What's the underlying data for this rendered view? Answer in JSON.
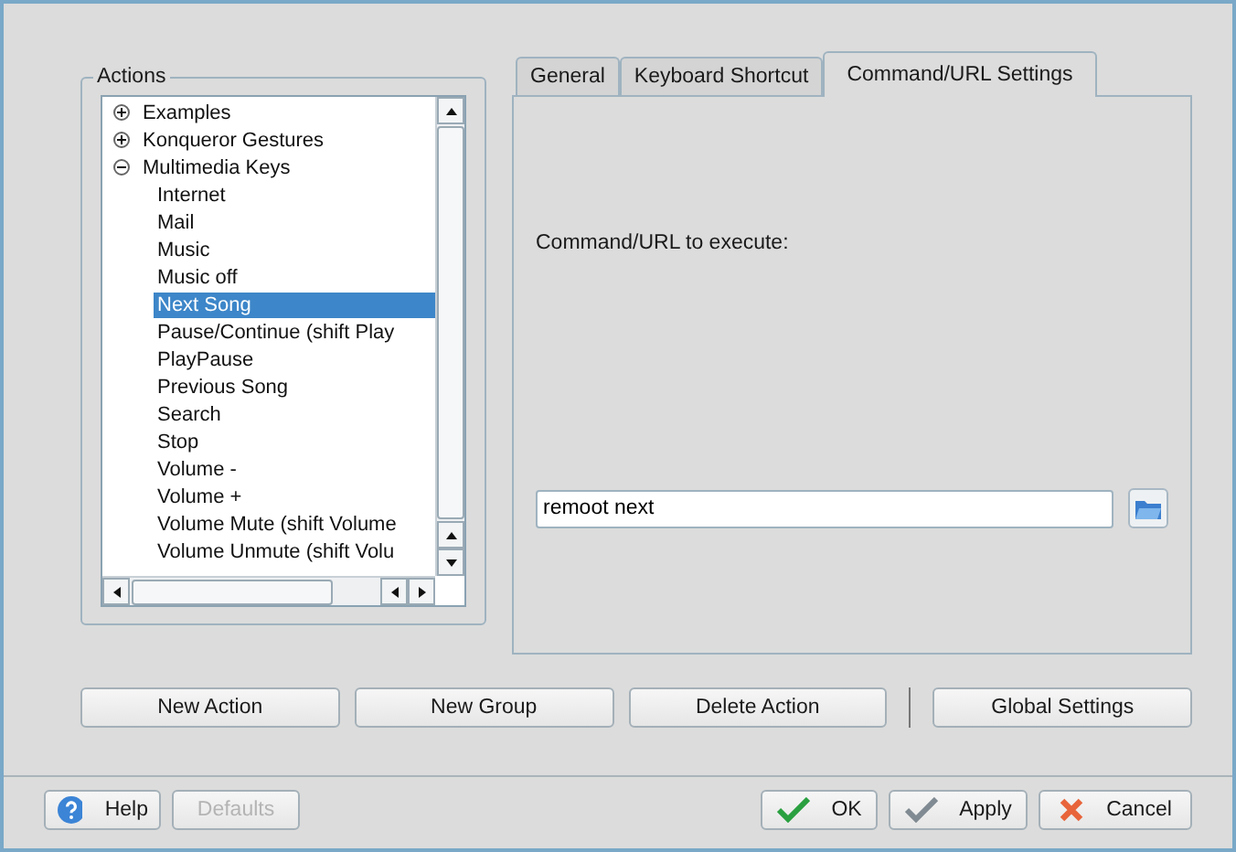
{
  "actions": {
    "title": "Actions",
    "tree": [
      {
        "label": "Examples",
        "expanded": false,
        "selected": false
      },
      {
        "label": "Konqueror Gestures",
        "expanded": false,
        "selected": false
      },
      {
        "label": "Multimedia Keys",
        "expanded": true,
        "selected": false,
        "children": [
          {
            "label": "Internet",
            "selected": false
          },
          {
            "label": "Mail",
            "selected": false
          },
          {
            "label": "Music",
            "selected": false
          },
          {
            "label": "Music off",
            "selected": false
          },
          {
            "label": "Next Song",
            "selected": true
          },
          {
            "label": "Pause/Continue (shift Play",
            "selected": false
          },
          {
            "label": "PlayPause",
            "selected": false
          },
          {
            "label": "Previous Song",
            "selected": false
          },
          {
            "label": "Search",
            "selected": false
          },
          {
            "label": "Stop",
            "selected": false
          },
          {
            "label": "Volume -",
            "selected": false
          },
          {
            "label": "Volume +",
            "selected": false
          },
          {
            "label": "Volume Mute (shift Volume",
            "selected": false
          },
          {
            "label": "Volume Unmute (shift Volu",
            "selected": false
          }
        ]
      }
    ]
  },
  "tabs": [
    {
      "label": "General",
      "selected": false
    },
    {
      "label": "Keyboard Shortcut",
      "selected": false
    },
    {
      "label": "Command/URL Settings",
      "selected": true
    }
  ],
  "command": {
    "label": "Command/URL to execute:",
    "value": "remoot next"
  },
  "action_buttons": [
    "New Action",
    "New Group",
    "Delete Action"
  ],
  "global_button": "Global Settings",
  "footer": {
    "left": [
      {
        "label": "Help",
        "kind": "help",
        "disabled": false
      },
      {
        "label": "Defaults",
        "kind": "plain",
        "disabled": true
      }
    ],
    "right": [
      {
        "label": "OK",
        "kind": "ok",
        "disabled": false
      },
      {
        "label": "Apply",
        "kind": "apply",
        "disabled": false
      },
      {
        "label": "Cancel",
        "kind": "cancel",
        "disabled": false
      }
    ]
  }
}
